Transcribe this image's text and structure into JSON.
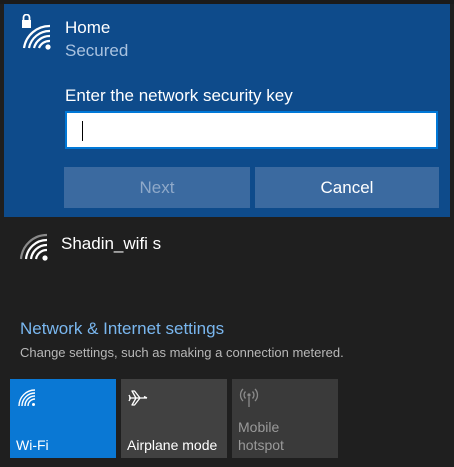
{
  "selected_network": {
    "name": "Home",
    "status": "Secured",
    "icon": "wifi-secured-icon",
    "key_prompt": "Enter the network security key",
    "key_value": "",
    "next_label": "Next",
    "cancel_label": "Cancel"
  },
  "other_networks": [
    {
      "name": "Shadin_wifi s",
      "icon": "wifi-signal-icon"
    }
  ],
  "settings": {
    "title": "Network & Internet settings",
    "description": "Change settings, such as making a connection metered."
  },
  "quick_actions": [
    {
      "label": "Wi-Fi",
      "icon": "wifi-icon",
      "state": "on"
    },
    {
      "label": "Airplane mode",
      "icon": "airplane-icon",
      "state": "off"
    },
    {
      "label_line1": "Mobile",
      "label_line2": "hotspot",
      "icon": "hotspot-icon",
      "state": "disabled"
    }
  ],
  "colors": {
    "flyout_background": "#1f1f1f",
    "selected_panel": "#0e4b8b",
    "accent": "#0a78d4",
    "link": "#7ab7ef"
  }
}
